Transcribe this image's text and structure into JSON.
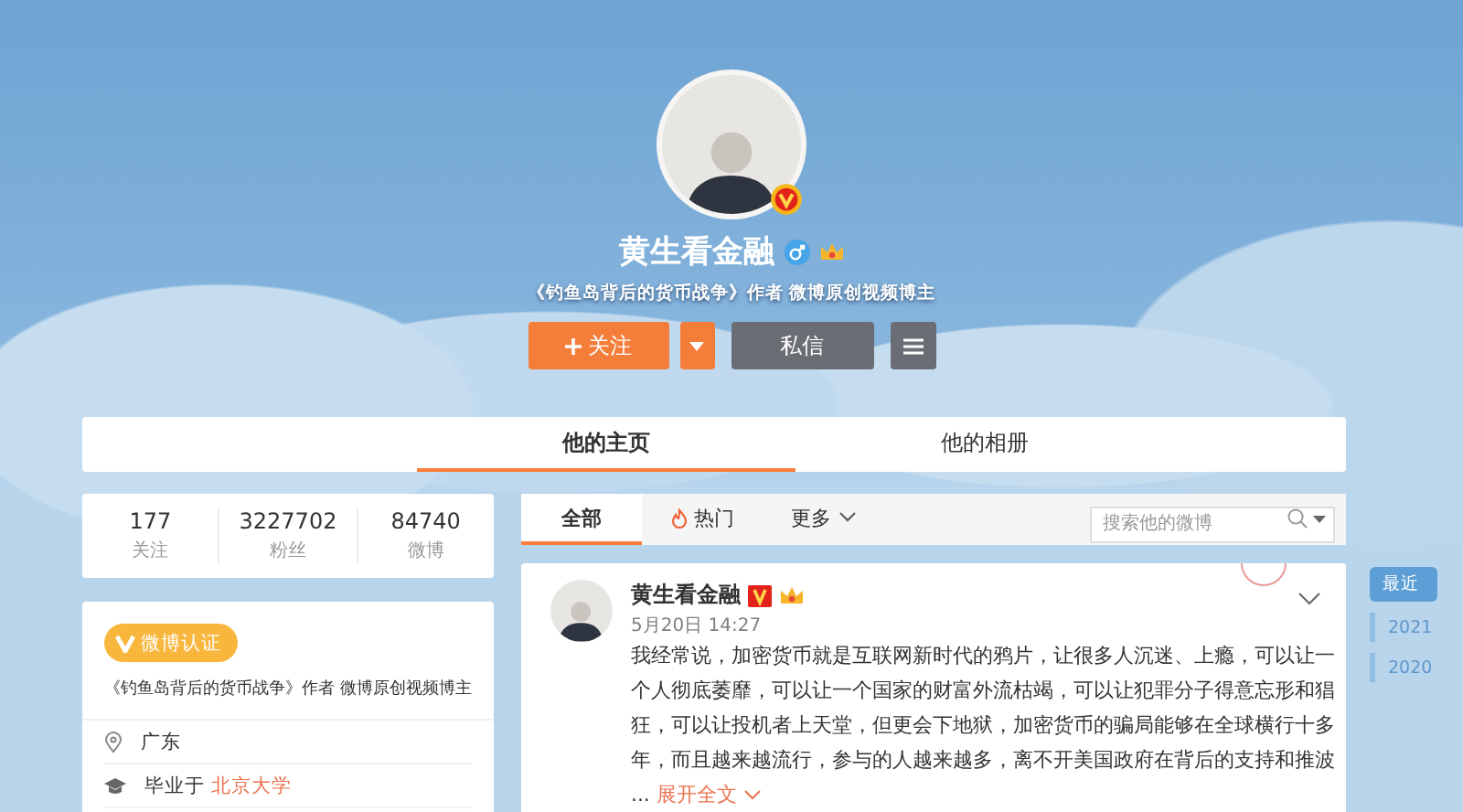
{
  "profile": {
    "name": "黄生看金融",
    "verified": true,
    "male": true,
    "vip": true,
    "bio": "《钓鱼岛背后的货币战争》作者 微博原创视频博主",
    "buttons": [
      {
        "kind": "follow",
        "label": "关注"
      },
      {
        "kind": "dropdown"
      },
      {
        "kind": "message",
        "label": "私信"
      },
      {
        "kind": "menu"
      }
    ]
  },
  "nav_tabs": [
    {
      "label": "他的主页",
      "selected": true
    },
    {
      "label": "他的相册",
      "selected": false
    }
  ],
  "stats": [
    {
      "value": "177",
      "label": "关注"
    },
    {
      "value": "3227702",
      "label": "粉丝"
    },
    {
      "value": "84740",
      "label": "微博"
    }
  ],
  "info": {
    "badge": "微博认证",
    "description": "《钓鱼岛背后的货币战争》作者 微博原创视频博主",
    "rows": [
      {
        "kind": "location",
        "text": "广东"
      },
      {
        "kind": "school",
        "text": "毕业于 ",
        "link": "北京大学"
      }
    ]
  },
  "feed_tabs": [
    {
      "label": "全部",
      "kind": "plain",
      "selected": true
    },
    {
      "label": "热门",
      "kind": "hot",
      "selected": false
    },
    {
      "label": "更多",
      "kind": "more",
      "selected": false
    }
  ],
  "search": {
    "placeholder": "搜索他的微博"
  },
  "post": {
    "author": "黄生看金融",
    "time": "5月20日 14:27",
    "text": "我经常说，加密货币就是互联网新时代的鸦片，让很多人沉迷、上瘾，可以让一个人彻底萎靡，可以让一个国家的财富外流枯竭，可以让犯罪分子得意忘形和猖狂，可以让投机者上天堂，但更会下地狱，加密货币的骗局能够在全球横行十多年，而且越来越流行，参与的人越来越多，离不开美国政府在背后的支持和推波",
    "ellipsis": "...",
    "expand": "展开全文"
  },
  "timeline": [
    {
      "label": "最近",
      "selected": true
    },
    {
      "label": "2021",
      "selected": false
    },
    {
      "label": "2020",
      "selected": false
    }
  ]
}
